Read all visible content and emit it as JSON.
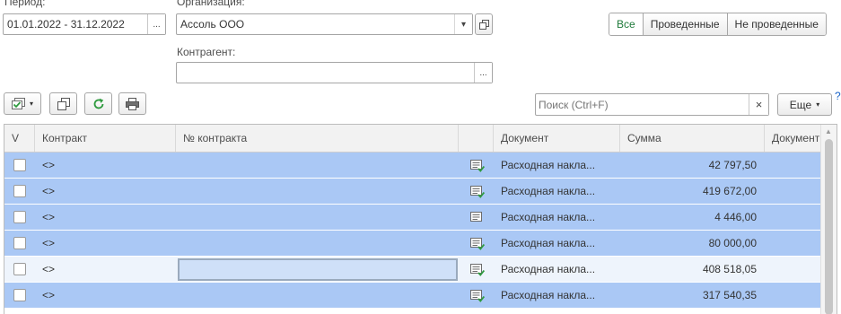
{
  "filters": {
    "period": {
      "label": "Период:",
      "value": "01.01.2022 - 31.12.2022"
    },
    "organization": {
      "label": "Организация:",
      "value": "Ассоль ООО"
    },
    "counterparty": {
      "label": "Контрагент:",
      "value": ""
    }
  },
  "status_filter": {
    "options": [
      "Все",
      "Проведенные",
      "Не проведенные"
    ],
    "selected": "Все"
  },
  "toolbar": {
    "search_placeholder": "Поиск (Ctrl+F)",
    "clear_glyph": "×",
    "more_label": "Еще",
    "help_glyph": "?",
    "ellipsis": "...",
    "dropdown_glyph": "▾"
  },
  "table": {
    "columns": [
      "V",
      "Контракт",
      "№ контракта",
      "",
      "Документ",
      "Сумма",
      "Документ"
    ],
    "rows": [
      {
        "contract": "<>",
        "contract_no": "",
        "doc_icon": "document-posted-icon",
        "document": "Расходная накла...",
        "sum": "42 797,50",
        "doc2": ""
      },
      {
        "contract": "<>",
        "contract_no": "",
        "doc_icon": "document-posted-icon",
        "document": "Расходная накла...",
        "sum": "419 672,00",
        "doc2": ""
      },
      {
        "contract": "<>",
        "contract_no": "",
        "doc_icon": "document-icon",
        "document": "Расходная накла...",
        "sum": "4 446,00",
        "doc2": ""
      },
      {
        "contract": "<>",
        "contract_no": "",
        "doc_icon": "document-posted-icon",
        "document": "Расходная накла...",
        "sum": "80 000,00",
        "doc2": ""
      },
      {
        "contract": "<>",
        "contract_no": "",
        "doc_icon": "document-posted-icon",
        "document": "Расходная накла...",
        "sum": "408 518,05",
        "doc2": ""
      },
      {
        "contract": "<>",
        "contract_no": "",
        "doc_icon": "document-posted-icon",
        "document": "Расходная накла...",
        "sum": "317 540,35",
        "doc2": ""
      }
    ]
  },
  "colors": {
    "selected_row": "#aac8f5",
    "current_row": "#eef4fc",
    "active_filter": "#1f7a3a"
  }
}
